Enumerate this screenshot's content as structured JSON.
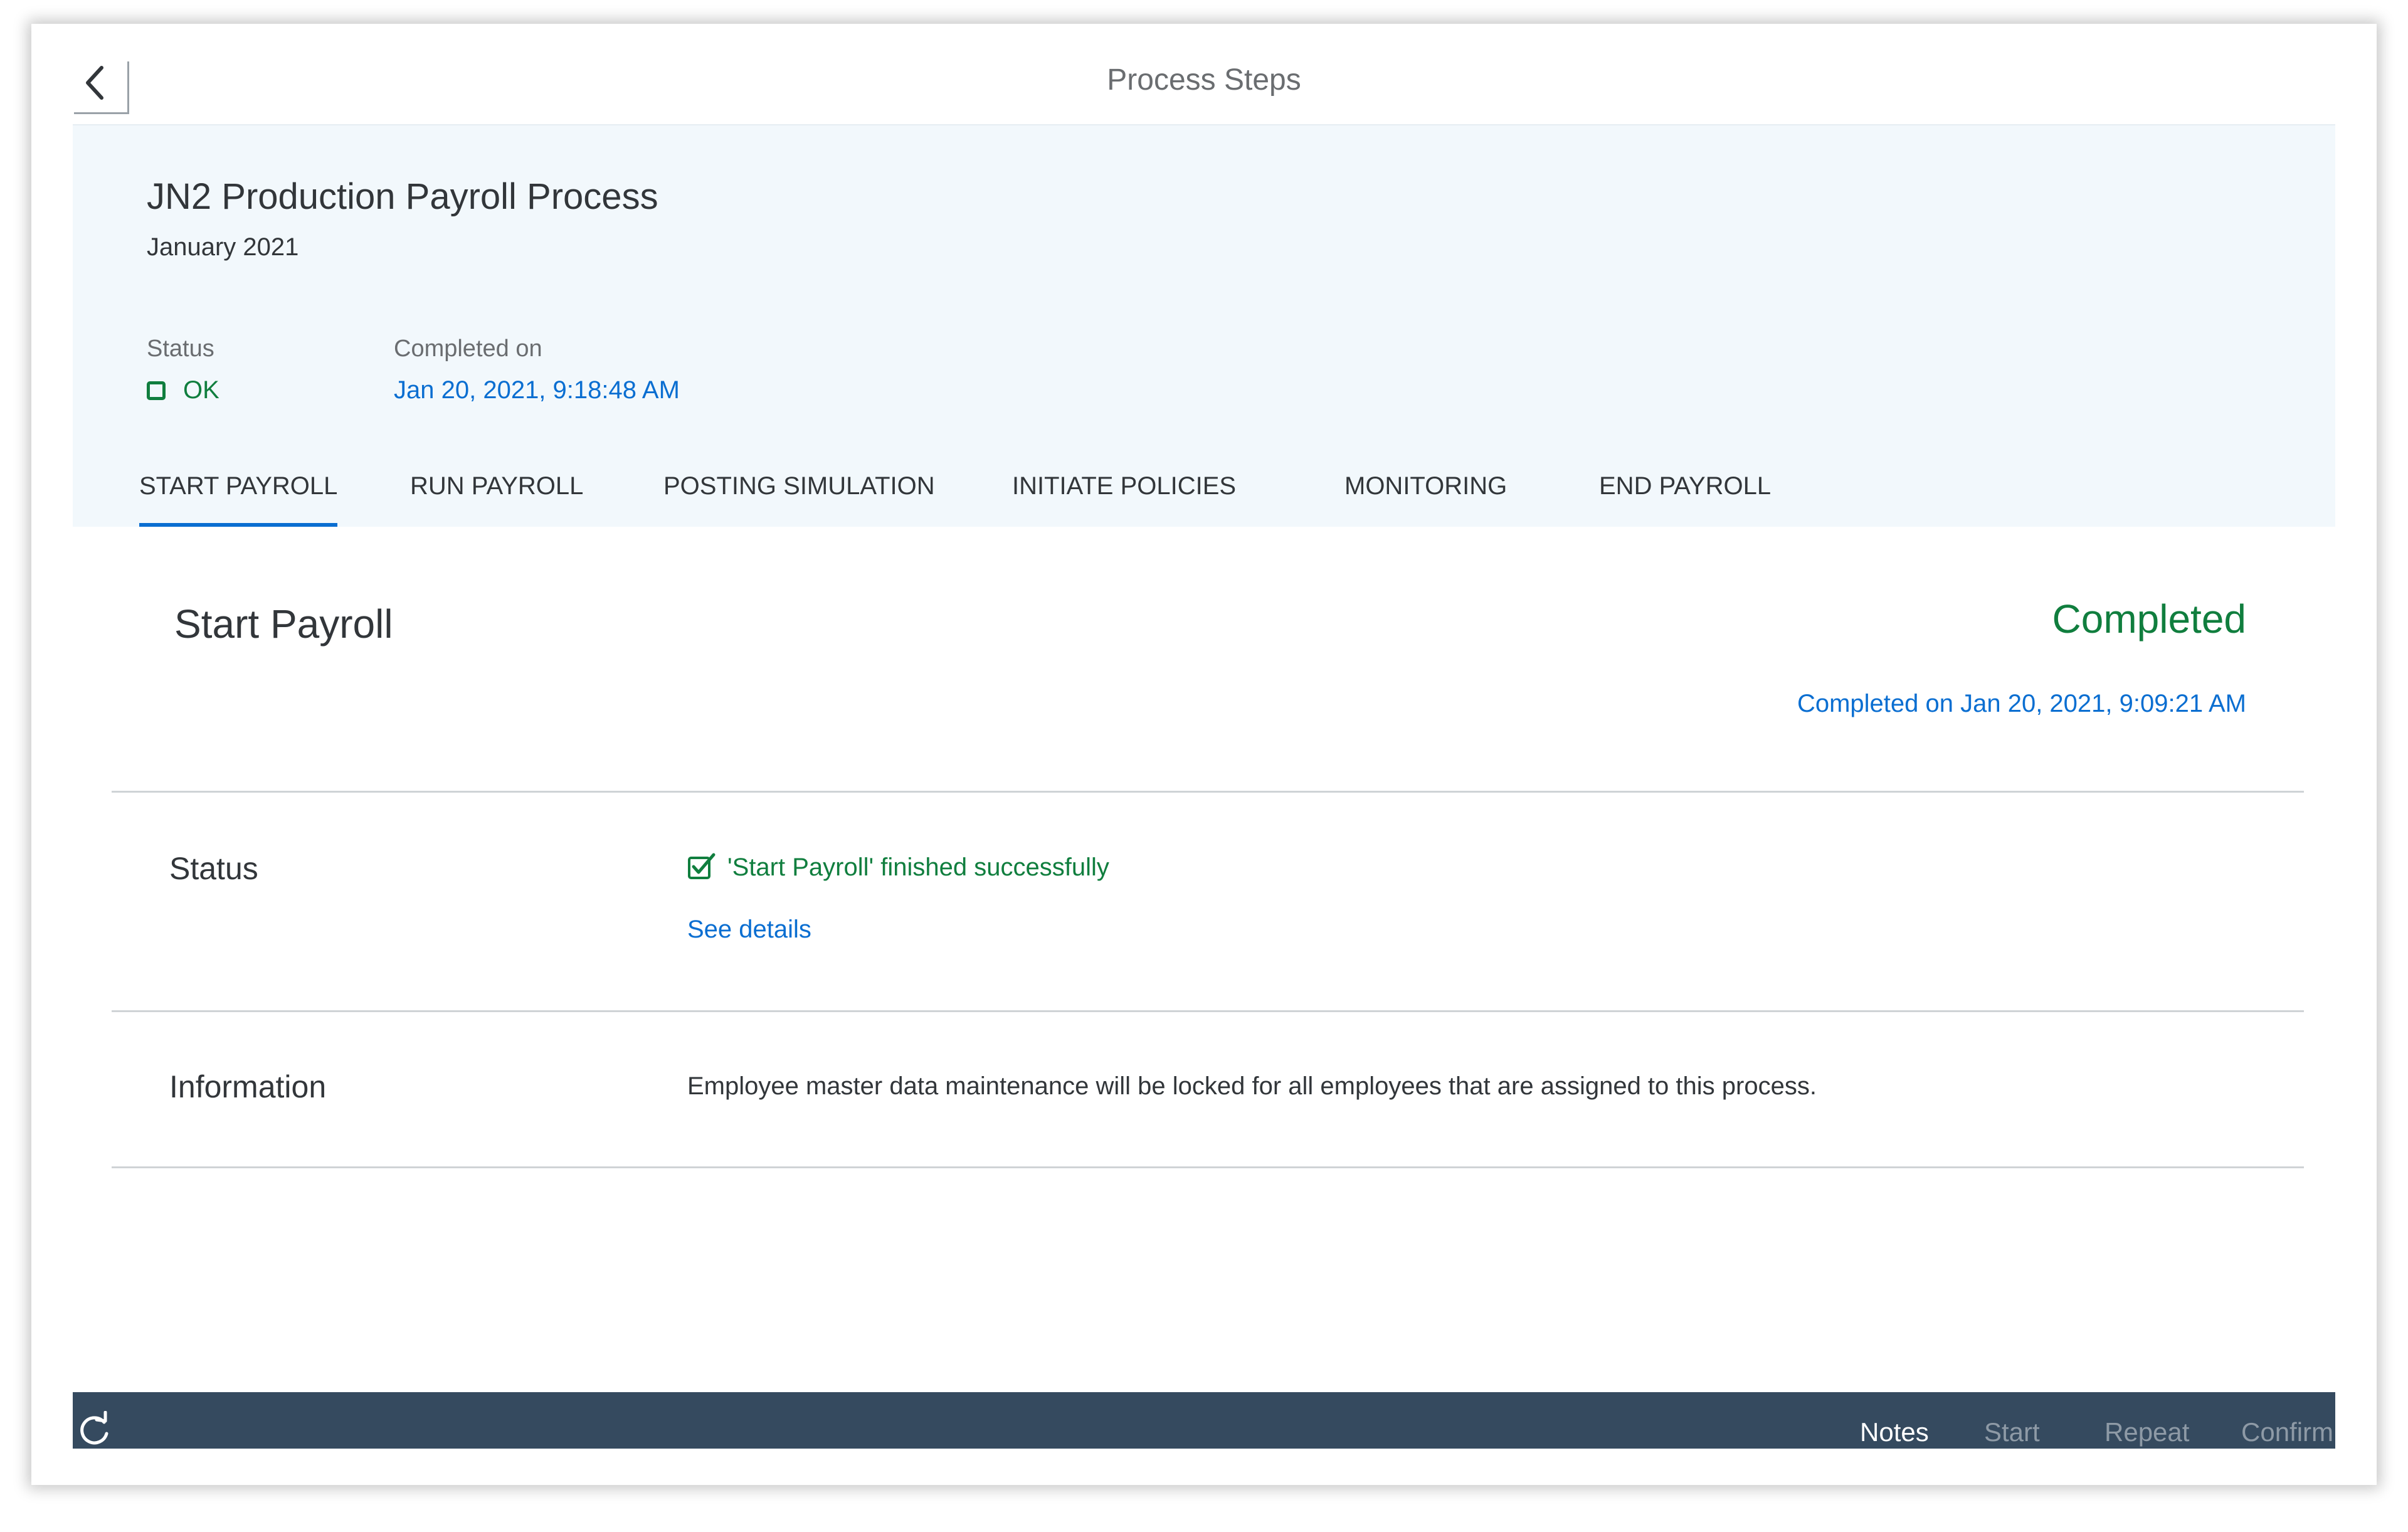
{
  "header": {
    "page_title": "Process Steps"
  },
  "object": {
    "title": "JN2 Production Payroll Process",
    "subtitle": "January 2021",
    "status_label": "Status",
    "status_value": "OK",
    "completed_label": "Completed on",
    "completed_value": "Jan 20, 2021, 9:18:48 AM"
  },
  "tabs": [
    {
      "label": "START PAYROLL",
      "active": true
    },
    {
      "label": "RUN PAYROLL",
      "active": false
    },
    {
      "label": "POSTING SIMULATION",
      "active": false
    },
    {
      "label": "INITIATE POLICIES",
      "active": false
    },
    {
      "label": "MONITORING",
      "active": false
    },
    {
      "label": "END PAYROLL",
      "active": false
    }
  ],
  "step": {
    "title": "Start Payroll",
    "state": "Completed",
    "completed_on": "Completed on Jan 20, 2021, 9:09:21 AM",
    "status_label": "Status",
    "status_message": "'Start Payroll' finished successfully",
    "see_details": "See details",
    "info_label": "Information",
    "info_text": "Employee master data maintenance will be locked for all employees that are assigned to this process."
  },
  "footer": {
    "buttons": [
      {
        "label": "Notes",
        "enabled": true
      },
      {
        "label": "Start",
        "enabled": false
      },
      {
        "label": "Repeat",
        "enabled": false
      },
      {
        "label": "Confirm",
        "enabled": false
      }
    ]
  },
  "colors": {
    "accent": "#0a6ed1",
    "success": "#107e3e",
    "footer_bg": "#354a5f",
    "header_bg": "#f2f8fc"
  },
  "icons": [
    "back-arrow-icon",
    "ok-square-icon",
    "checkbox-check-icon",
    "refresh-icon"
  ]
}
